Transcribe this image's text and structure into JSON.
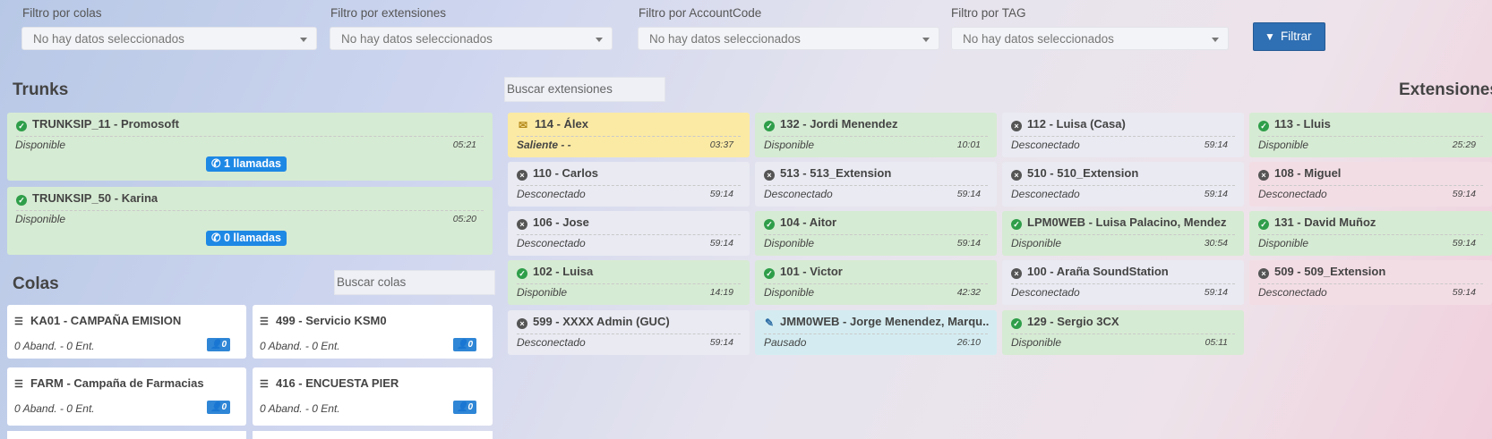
{
  "filters": {
    "colas": {
      "label": "Filtro por colas",
      "value": "No hay datos seleccionados"
    },
    "extensiones": {
      "label": "Filtro por extensiones",
      "value": "No hay datos seleccionados"
    },
    "accountcode": {
      "label": "Filtro por AccountCode",
      "value": "No hay datos seleccionados"
    },
    "tag": {
      "label": "Filtro por TAG",
      "value": "No hay datos seleccionados"
    },
    "button_label": "Filtrar"
  },
  "trunks": {
    "title": "Trunks",
    "items": [
      {
        "name": "TRUNKSIP_11 - Promosoft",
        "status": "Disponible",
        "time": "05:21",
        "calls": "1 llamadas"
      },
      {
        "name": "TRUNKSIP_50 - Karina",
        "status": "Disponible",
        "time": "05:20",
        "calls": "0 llamadas"
      }
    ]
  },
  "colas": {
    "title": "Colas",
    "search_placeholder": "Buscar colas",
    "items": [
      {
        "name": "KA01 - CAMPAÑA EMISION",
        "stats": "0 Aband. - 0 Ent.",
        "agents": "0"
      },
      {
        "name": "499 - Servicio KSM0",
        "stats": "0 Aband. - 0 Ent.",
        "agents": "0"
      },
      {
        "name": "FARM - Campaña de Farmacias",
        "stats": "0 Aband. - 0 Ent.",
        "agents": "0"
      },
      {
        "name": "416 - ENCUESTA PIER",
        "stats": "0 Aband. - 0 Ent.",
        "agents": "0"
      }
    ]
  },
  "extensions": {
    "title": "Extensiones",
    "search_placeholder": "Buscar extensiones",
    "columns": [
      [
        {
          "name": "114 - Álex",
          "status": "Saliente - -",
          "time": "03:37",
          "state": "yellow",
          "icon": "chat-icon"
        },
        {
          "name": "110 - Carlos",
          "status": "Desconectado",
          "time": "59:14",
          "state": "grey",
          "icon": "x-circle-icon"
        },
        {
          "name": "106 - Jose",
          "status": "Desconectado",
          "time": "59:14",
          "state": "grey",
          "icon": "x-circle-icon"
        },
        {
          "name": "102 - Luisa",
          "status": "Disponible",
          "time": "14:19",
          "state": "green",
          "icon": "check-circle-icon"
        },
        {
          "name": "599 - XXXX Admin (GUC)",
          "status": "Desconectado",
          "time": "59:14",
          "state": "grey",
          "icon": "x-circle-icon"
        }
      ],
      [
        {
          "name": "132 - Jordi Menendez",
          "status": "Disponible",
          "time": "10:01",
          "state": "green",
          "icon": "check-circle-icon"
        },
        {
          "name": "513 - 513_Extension",
          "status": "Desconectado",
          "time": "59:14",
          "state": "grey",
          "icon": "x-circle-icon"
        },
        {
          "name": "104 - Aitor",
          "status": "Disponible",
          "time": "59:14",
          "state": "green",
          "icon": "check-circle-icon"
        },
        {
          "name": "101 - Victor",
          "status": "Disponible",
          "time": "42:32",
          "state": "green",
          "icon": "check-circle-icon"
        },
        {
          "name": "JMM0WEB - Jorge Menendez, Marqu...",
          "status": "Pausado",
          "time": "26:10",
          "state": "blue",
          "icon": "pencil-icon"
        }
      ],
      [
        {
          "name": "112 - Luisa (Casa)",
          "status": "Desconectado",
          "time": "59:14",
          "state": "grey",
          "icon": "x-circle-icon"
        },
        {
          "name": "510 - 510_Extension",
          "status": "Desconectado",
          "time": "59:14",
          "state": "grey",
          "icon": "x-circle-icon"
        },
        {
          "name": "LPM0WEB - Luisa Palacino, Mendez",
          "status": "Disponible",
          "time": "30:54",
          "state": "green",
          "icon": "check-circle-icon"
        },
        {
          "name": "100 - Araña SoundStation",
          "status": "Desconectado",
          "time": "59:14",
          "state": "grey",
          "icon": "x-circle-icon"
        },
        {
          "name": "129 - Sergio 3CX",
          "status": "Disponible",
          "time": "05:11",
          "state": "green",
          "icon": "check-circle-icon"
        }
      ],
      [
        {
          "name": "113 - Lluis",
          "status": "Disponible",
          "time": "25:29",
          "state": "green",
          "icon": "check-circle-icon"
        },
        {
          "name": "108 - Miguel",
          "status": "Desconectado",
          "time": "59:14",
          "state": "pink",
          "icon": "x-circle-icon"
        },
        {
          "name": "131 - David Muñoz",
          "status": "Disponible",
          "time": "59:14",
          "state": "green",
          "icon": "check-circle-icon"
        },
        {
          "name": "509 - 509_Extension",
          "status": "Desconectado",
          "time": "59:14",
          "state": "pink",
          "icon": "x-circle-icon"
        }
      ]
    ]
  }
}
